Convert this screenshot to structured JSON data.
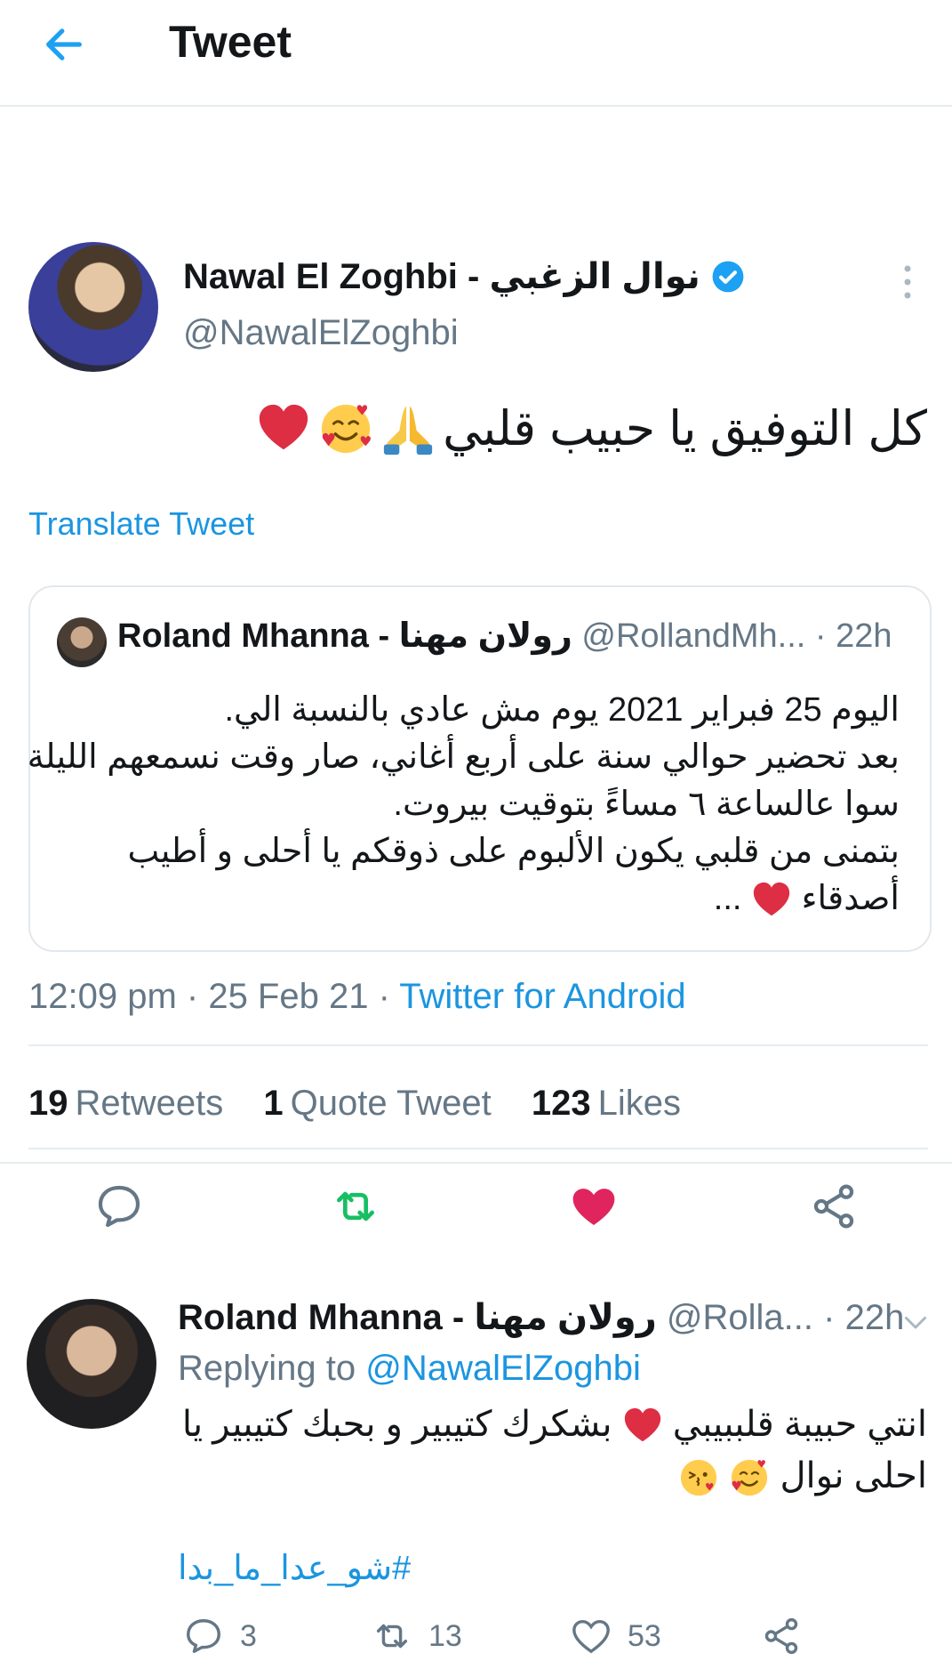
{
  "header": {
    "title": "Tweet",
    "back_icon": "arrow-left-icon"
  },
  "tweet": {
    "display_name": "Nawal El Zoghbi - نوال الزغبي",
    "handle": "@NawalElZoghbi",
    "verified_icon": "verified-badge-icon",
    "more_icon": "more-vertical-icon",
    "text": "كل التوفيق يا حبيب قلبي",
    "emojis": [
      "folded-hands-icon",
      "smiling-face-hearts-icon",
      "red-heart-icon"
    ],
    "translate_label": "Translate Tweet",
    "time": "12:09 pm",
    "date": "25 Feb 21",
    "source": "Twitter for Android",
    "stats": {
      "retweets_count": "19",
      "retweets_label": "Retweets",
      "quote_count": "1",
      "quote_label": "Quote Tweet",
      "likes_count": "123",
      "likes_label": "Likes"
    }
  },
  "quoted": {
    "name": "Roland Mhanna - رولان مهنا",
    "handle": "@RollandMh...",
    "time": "· 22h",
    "lines": [
      "اليوم 25 فبراير 2021 يوم مش عادي بالنسبة الي.",
      "بعد تحضير حوالي سنة على أربع أغاني، صار وقت نسمعهم الليلة",
      "سوا عالساعة ٦ مساءً بتوقيت بيروت.",
      "بتمنى من قلبي يكون الألبوم على ذوقكم يا أحلى و أطيب",
      "أصدقاء"
    ],
    "ellipsis": "..."
  },
  "actions": {
    "reply_icon": "reply-icon",
    "retweet_icon": "retweet-icon",
    "like_icon": "heart-icon",
    "share_icon": "share-icon"
  },
  "reply": {
    "name": "Roland Mhanna - رولان مهنا",
    "handle": "@Rolla...",
    "time": "· 22h",
    "replying_prefix": "Replying to",
    "replying_mention": "@NawalElZoghbi",
    "line1_a": "انتي حبيبة قلببيبي",
    "line1_b": "بشكرك كتيبير و بحبك كتيبير يا",
    "line2": "احلى نوال",
    "hashtag": "#شو_عدا_ما_بدا",
    "reply_count": "3",
    "retweet_count": "13",
    "like_count": "53"
  }
}
